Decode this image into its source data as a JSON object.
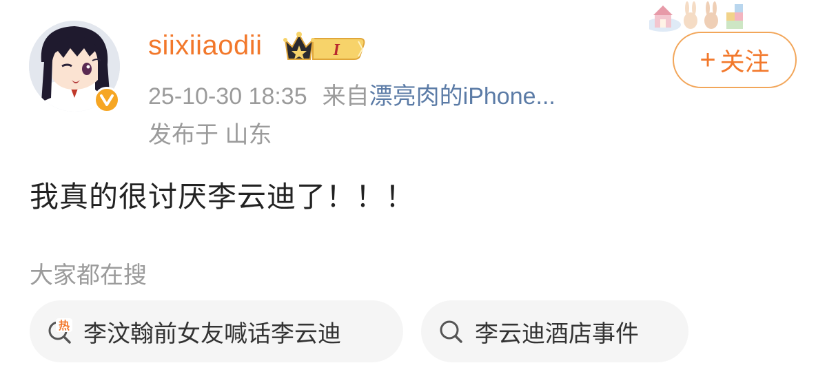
{
  "post": {
    "user": {
      "name": "siixiiaodii",
      "vip_level": "I",
      "verified_color": "#f6a623"
    },
    "meta": {
      "time": "25-10-30 18:35",
      "source_prefix": "来自",
      "source": "漂亮肉的iPhone...",
      "location": "发布于 山东"
    },
    "follow_button": {
      "plus": "+",
      "label": "关注"
    },
    "text": "我真的很讨厌李云迪了！！！"
  },
  "search_section": {
    "label": "大家都在搜",
    "items": [
      {
        "label": "李汶翰前女友喊话李云迪",
        "icon": "hot-search-icon",
        "icon_text": "热"
      },
      {
        "label": "李云迪酒店事件",
        "icon": "search-icon"
      }
    ]
  },
  "colors": {
    "username": "#f2782b",
    "source_link": "#5b7ba6",
    "muted_text": "#9b9b9b",
    "follow_border": "#f2a65a",
    "chip_background": "#f5f5f5"
  }
}
